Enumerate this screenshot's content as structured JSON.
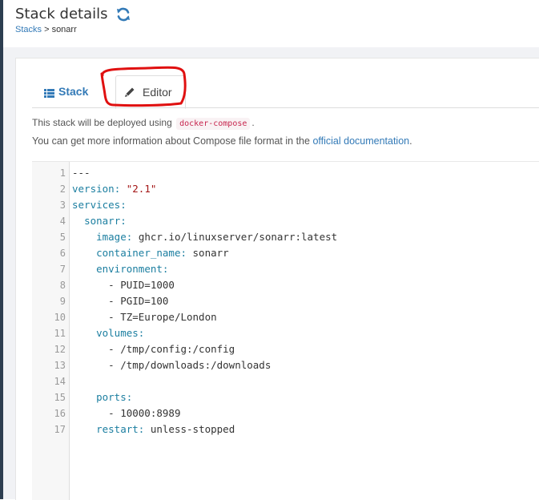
{
  "header": {
    "title": "Stack details",
    "breadcrumb": {
      "parent": "Stacks",
      "separator": " > ",
      "current": "sonarr"
    }
  },
  "tabs": [
    {
      "label": "Stack",
      "icon": "list-icon",
      "active": false
    },
    {
      "label": "Editor",
      "icon": "pencil-icon",
      "active": true
    }
  ],
  "info": {
    "deploy_prefix": "This stack will be deployed using ",
    "deploy_code": "docker-compose",
    "deploy_suffix": ".",
    "docs_prefix": "You can get more information about Compose file format in the ",
    "docs_link": "official documentation",
    "docs_suffix": "."
  },
  "colors": {
    "accent": "#337ab7",
    "annotation": "#e01010",
    "yaml_key": "#1b7ea0",
    "yaml_string": "#a31515"
  },
  "editor": {
    "lines": [
      {
        "num": "1",
        "indent": "",
        "key": "",
        "sep": "",
        "value": "---",
        "vtype": "plain"
      },
      {
        "num": "2",
        "indent": "",
        "key": "version",
        "sep": ": ",
        "value": "\"2.1\"",
        "vtype": "string"
      },
      {
        "num": "3",
        "indent": "",
        "key": "services",
        "sep": ":",
        "value": "",
        "vtype": "plain"
      },
      {
        "num": "4",
        "indent": "  ",
        "key": "sonarr",
        "sep": ":",
        "value": "",
        "vtype": "plain"
      },
      {
        "num": "5",
        "indent": "    ",
        "key": "image",
        "sep": ": ",
        "value": "ghcr.io/linuxserver/sonarr:latest",
        "vtype": "plain"
      },
      {
        "num": "6",
        "indent": "    ",
        "key": "container_name",
        "sep": ": ",
        "value": "sonarr",
        "vtype": "plain"
      },
      {
        "num": "7",
        "indent": "    ",
        "key": "environment",
        "sep": ":",
        "value": "",
        "vtype": "plain"
      },
      {
        "num": "8",
        "indent": "      ",
        "key": "",
        "sep": "",
        "value": "- PUID=1000",
        "vtype": "plain"
      },
      {
        "num": "9",
        "indent": "      ",
        "key": "",
        "sep": "",
        "value": "- PGID=100",
        "vtype": "plain"
      },
      {
        "num": "10",
        "indent": "      ",
        "key": "",
        "sep": "",
        "value": "- TZ=Europe/London",
        "vtype": "plain"
      },
      {
        "num": "11",
        "indent": "    ",
        "key": "volumes",
        "sep": ":",
        "value": "",
        "vtype": "plain"
      },
      {
        "num": "12",
        "indent": "      ",
        "key": "",
        "sep": "",
        "value": "- /tmp/config:/config",
        "vtype": "plain"
      },
      {
        "num": "13",
        "indent": "      ",
        "key": "",
        "sep": "",
        "value": "- /tmp/downloads:/downloads",
        "vtype": "plain"
      },
      {
        "num": "14",
        "indent": "",
        "key": "",
        "sep": "",
        "value": "",
        "vtype": "plain"
      },
      {
        "num": "15",
        "indent": "    ",
        "key": "ports",
        "sep": ":",
        "value": "",
        "vtype": "plain"
      },
      {
        "num": "16",
        "indent": "      ",
        "key": "",
        "sep": "",
        "value": "- 10000:8989",
        "vtype": "plain"
      },
      {
        "num": "17",
        "indent": "    ",
        "key": "restart",
        "sep": ": ",
        "value": "unless-stopped",
        "vtype": "plain"
      }
    ]
  }
}
